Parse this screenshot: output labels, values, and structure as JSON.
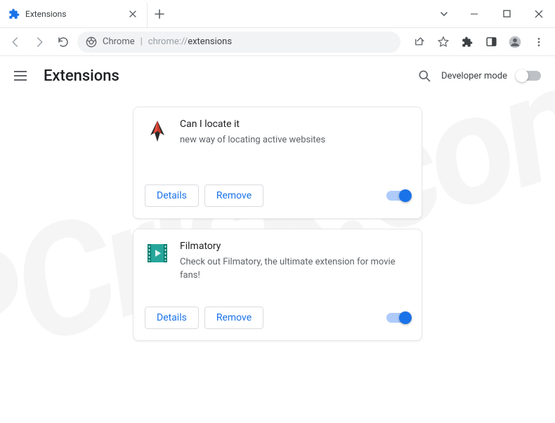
{
  "window": {
    "tab_title": "Extensions"
  },
  "addressbar": {
    "scheme": "Chrome",
    "url_prefix": "chrome://",
    "url_path": "extensions"
  },
  "page": {
    "title": "Extensions",
    "dev_mode_label": "Developer mode",
    "dev_mode_on": false
  },
  "buttons": {
    "details": "Details",
    "remove": "Remove"
  },
  "extensions": [
    {
      "name": "Can I locate it",
      "description": "new way of locating active websites",
      "enabled": true,
      "icon": "bird-icon"
    },
    {
      "name": "Filmatory",
      "description": "Check out Filmatory, the ultimate extension for movie fans!",
      "enabled": true,
      "icon": "film-icon"
    }
  ],
  "watermark": "PCrisk.com"
}
